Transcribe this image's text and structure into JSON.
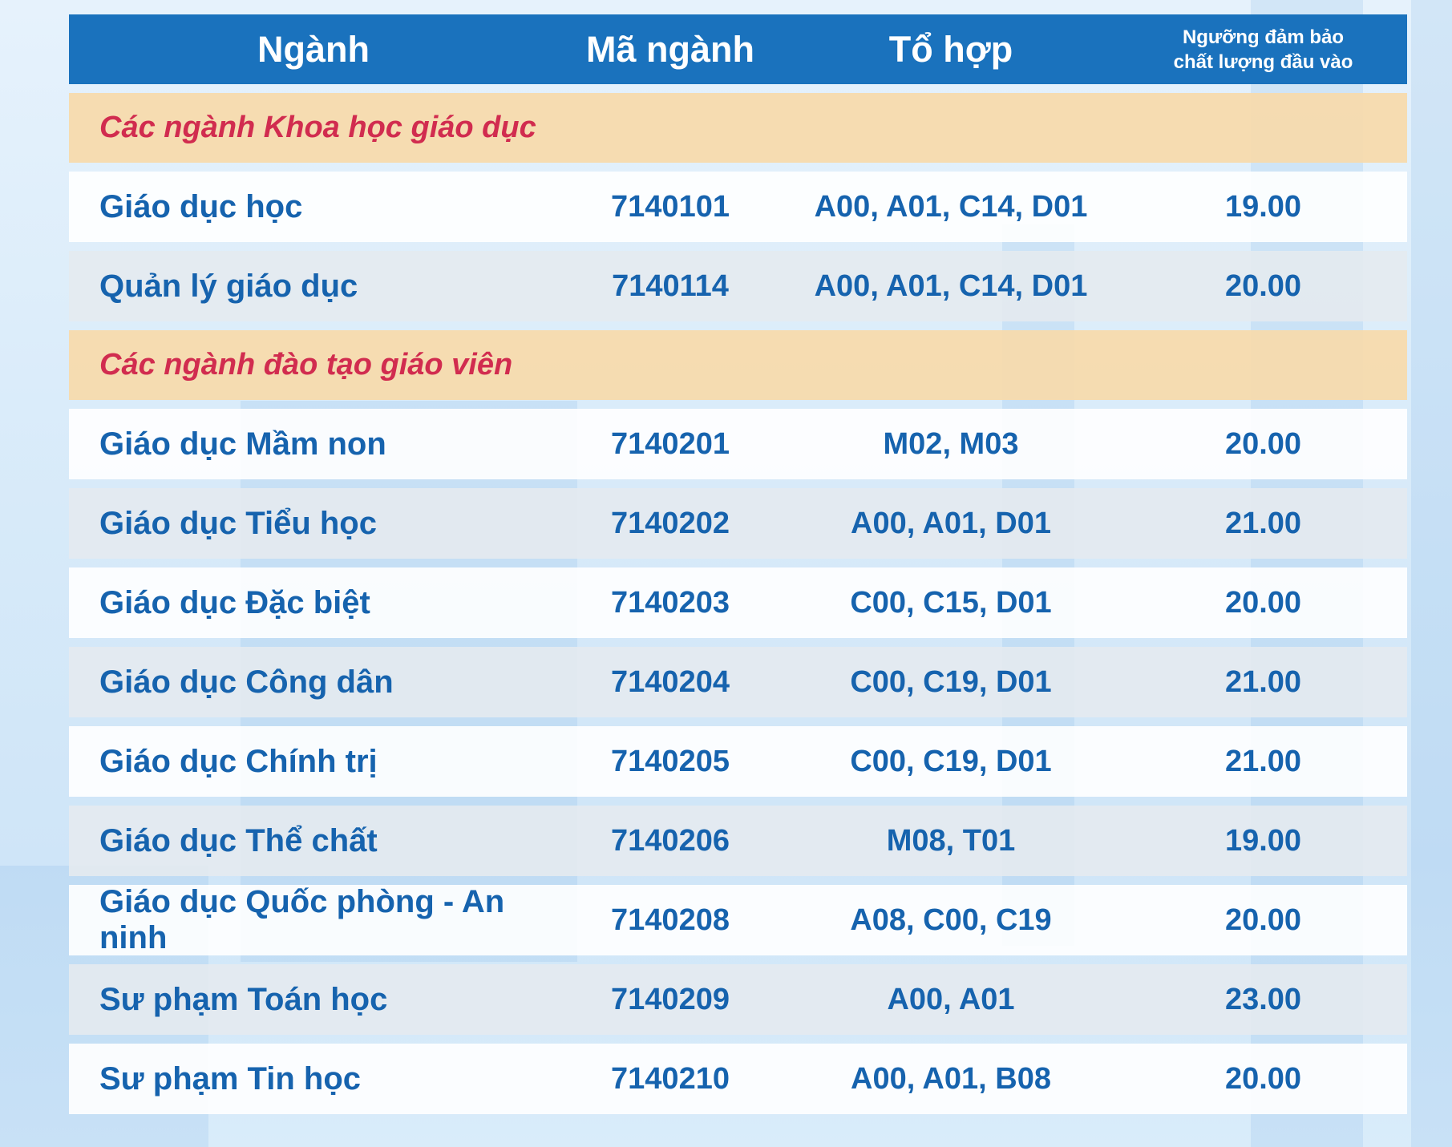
{
  "header": {
    "major": "Ngành",
    "code": "Mã ngành",
    "combination": "Tổ hợp",
    "threshold_line1": "Ngưỡng đảm bảo",
    "threshold_line2": "chất lượng đầu vào"
  },
  "sections": [
    {
      "title": "Các ngành Khoa học giáo dục",
      "rows": [
        {
          "name": "Giáo dục học",
          "code": "7140101",
          "combination": "A00, A01, C14, D01",
          "score": "19.00"
        },
        {
          "name": "Quản lý giáo dục",
          "code": "7140114",
          "combination": "A00, A01, C14, D01",
          "score": "20.00"
        }
      ]
    },
    {
      "title": "Các ngành đào tạo giáo viên",
      "rows": [
        {
          "name": "Giáo dục Mầm non",
          "code": "7140201",
          "combination": "M02, M03",
          "score": "20.00"
        },
        {
          "name": "Giáo dục Tiểu học",
          "code": "7140202",
          "combination": "A00, A01, D01",
          "score": "21.00"
        },
        {
          "name": "Giáo dục Đặc biệt",
          "code": "7140203",
          "combination": "C00, C15, D01",
          "score": "20.00"
        },
        {
          "name": "Giáo dục Công dân",
          "code": "7140204",
          "combination": "C00, C19, D01",
          "score": "21.00"
        },
        {
          "name": "Giáo dục Chính trị",
          "code": "7140205",
          "combination": "C00, C19, D01",
          "score": "21.00"
        },
        {
          "name": "Giáo dục Thể chất",
          "code": "7140206",
          "combination": "M08, T01",
          "score": "19.00"
        },
        {
          "name": "Giáo dục Quốc phòng - An ninh",
          "code": "7140208",
          "combination": "A08, C00, C19",
          "score": "20.00"
        },
        {
          "name": "Sư phạm Toán học",
          "code": "7140209",
          "combination": "A00, A01",
          "score": "23.00"
        },
        {
          "name": "Sư phạm Tin học",
          "code": "7140210",
          "combination": "A00, A01, B08",
          "score": "20.00"
        }
      ]
    }
  ]
}
